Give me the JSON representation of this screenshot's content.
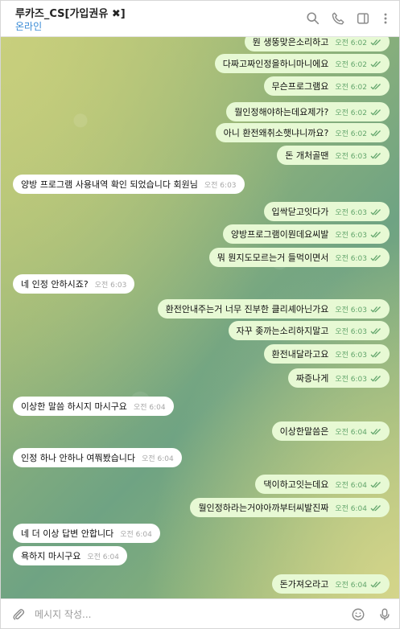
{
  "header": {
    "title": "루카즈_CS[가입권유 ✖]",
    "status": "온라인",
    "icons": [
      "search-icon",
      "phone-icon",
      "sidebar-toggle-icon",
      "more-menu-icon"
    ]
  },
  "messages": [
    {
      "dir": "out",
      "text": "뭔 생뚱맞은소리하고",
      "time": "오전 6:02",
      "read": true
    },
    {
      "dir": "out",
      "text": "다짜고짜인정을하니마니에요",
      "time": "오전 6:02",
      "read": true
    },
    {
      "dir": "out",
      "text": "무슨프로그램요",
      "time": "오전 6:02",
      "read": true
    },
    {
      "dir": "out",
      "text": "뭘인정해야하는데요제가?",
      "time": "오전 6:02",
      "read": true
    },
    {
      "dir": "out",
      "text": "아니 환전왜취소햇냐니까요?",
      "time": "오전 6:02",
      "read": true
    },
    {
      "dir": "out",
      "text": "돈 개처골땐",
      "time": "오전 6:03",
      "read": true
    },
    {
      "dir": "in",
      "text": "양방 프로그램 사용내역 확인 되었습니다 회원님",
      "time": "오전 6:03"
    },
    {
      "dir": "out",
      "text": "입싹닫고잇다가",
      "time": "오전 6:03",
      "read": true
    },
    {
      "dir": "out",
      "text": "양방프로그램이뭔데요씨발",
      "time": "오전 6:03",
      "read": true
    },
    {
      "dir": "out",
      "text": "뭐 뭔지도모르는거 들먹이면서",
      "time": "오전 6:03",
      "read": true
    },
    {
      "dir": "in",
      "text": "네 인정 안하시죠?",
      "time": "오전 6:03"
    },
    {
      "dir": "out",
      "text": "환전안내주는거 너무 진부한 클리셰아닌가요",
      "time": "오전 6:03",
      "read": true
    },
    {
      "dir": "out",
      "text": "자꾸 좆까는소리하지말고",
      "time": "오전 6:03",
      "read": true
    },
    {
      "dir": "out",
      "text": "환전내달라고요",
      "time": "오전 6:03",
      "read": true
    },
    {
      "dir": "out",
      "text": "짜증나게",
      "time": "오전 6:03",
      "read": true
    },
    {
      "dir": "in",
      "text": "이상한 말씀 하시지 마시구요",
      "time": "오전 6:04"
    },
    {
      "dir": "out",
      "text": "이상한말씀은",
      "time": "오전 6:04",
      "read": true
    },
    {
      "dir": "in",
      "text": "인정 하나 안하나 여쭤봤습니다",
      "time": "오전 6:04"
    },
    {
      "dir": "out",
      "text": "댁이하고잇는데요",
      "time": "오전 6:04",
      "read": true
    },
    {
      "dir": "out",
      "text": "뭘인정하라는거야아까부터씨발진짜",
      "time": "오전 6:04",
      "read": true
    },
    {
      "dir": "in",
      "text": "네 더 이상 답변 안합니다",
      "time": "오전 6:04"
    },
    {
      "dir": "in",
      "text": "욕하지 마시구요",
      "time": "오전 6:04"
    },
    {
      "dir": "out",
      "text": "돈가져오라고",
      "time": "오전 6:04",
      "read": true
    }
  ],
  "composer": {
    "placeholder": "메시지 작성...",
    "value": "",
    "icons": [
      "attach-icon",
      "emoji-icon",
      "microphone-icon"
    ]
  },
  "colors": {
    "outgoing_bubble": "#e7f9d4",
    "incoming_bubble": "#ffffff",
    "status_online": "#3a8bd6",
    "read_check": "#62a56b"
  }
}
